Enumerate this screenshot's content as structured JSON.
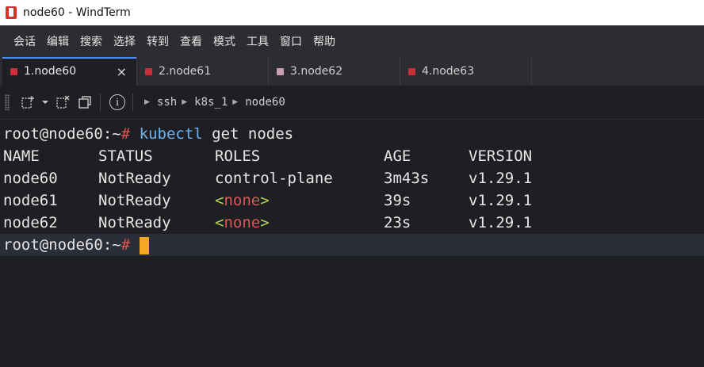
{
  "window": {
    "title": "node60 - WindTerm"
  },
  "menu": [
    "会话",
    "编辑",
    "搜索",
    "选择",
    "转到",
    "查看",
    "模式",
    "工具",
    "窗口",
    "帮助"
  ],
  "tabs": [
    {
      "label": "1.node60",
      "marker_color": "#c8313a",
      "active": true,
      "close": "×"
    },
    {
      "label": "2.node61",
      "marker_color": "#c8313a",
      "active": false
    },
    {
      "label": "3.node62",
      "marker_color": "#c8a0b0",
      "active": false
    },
    {
      "label": "4.node63",
      "marker_color": "#c8313a",
      "active": false
    }
  ],
  "toolbar": {
    "breadcrumb": [
      "ssh",
      "k8s_1",
      "node60"
    ],
    "info_glyph": "i"
  },
  "terminal": {
    "prompt_user": "root@node60:~",
    "prompt_hash": "#",
    "command": "kubectl",
    "command_args": "get nodes",
    "headers": [
      "NAME",
      "STATUS",
      "ROLES",
      "AGE",
      "VERSION"
    ],
    "rows": [
      {
        "name": "node60",
        "status": "NotReady",
        "roles": "control-plane",
        "age": "3m43s",
        "version": "v1.29.1"
      },
      {
        "name": "node61",
        "status": "NotReady",
        "roles": "<none>",
        "age": "39s",
        "version": "v1.29.1"
      },
      {
        "name": "node62",
        "status": "NotReady",
        "roles": "<none>",
        "age": "23s",
        "version": "v1.29.1"
      }
    ],
    "none_parts": {
      "lt": "<",
      "word": "none",
      "gt": ">"
    },
    "cursor_color": "#f5a623"
  }
}
